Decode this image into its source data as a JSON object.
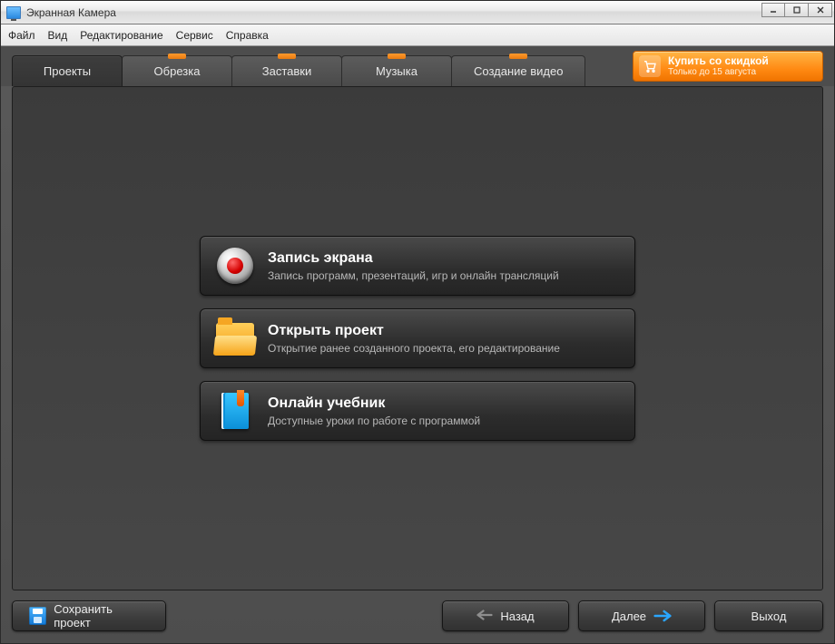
{
  "title": "Экранная Камера",
  "menu": [
    "Файл",
    "Вид",
    "Редактирование",
    "Сервис",
    "Справка"
  ],
  "tabs": [
    "Проекты",
    "Обрезка",
    "Заставки",
    "Музыка",
    "Создание видео"
  ],
  "buy": {
    "line1": "Купить со скидкой",
    "line2": "Только до 15 августа"
  },
  "cards": {
    "record": {
      "title": "Запись экрана",
      "sub": "Запись программ, презентаций, игр и онлайн трансляций"
    },
    "open": {
      "title": "Открыть проект",
      "sub": "Открытие ранее созданного проекта, его редактирование"
    },
    "learn": {
      "title": "Онлайн учебник",
      "sub": "Доступные уроки по работе с программой"
    }
  },
  "footer": {
    "save": "Сохранить проект",
    "back": "Назад",
    "next": "Далее",
    "exit": "Выход"
  }
}
